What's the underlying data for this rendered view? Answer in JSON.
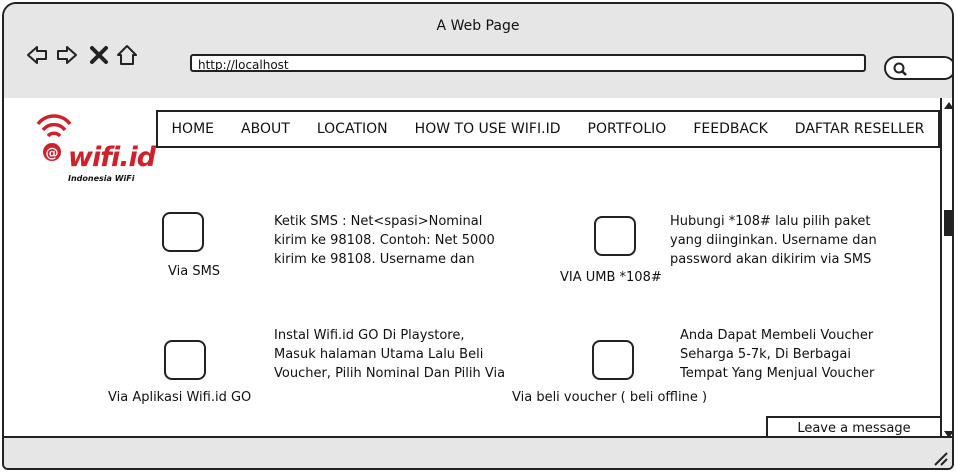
{
  "window": {
    "title": "A Web Page",
    "url": "http://localhost",
    "nav_icons": [
      "back-arrow-icon",
      "forward-arrow-icon",
      "close-x-icon",
      "home-icon"
    ],
    "search_icon": "search-icon"
  },
  "logo": {
    "brand": "wifi.id",
    "tagline": "Indonesia WiFi",
    "color": "#d0202a"
  },
  "menu": {
    "items": [
      "HOME",
      "ABOUT",
      "LOCATION",
      "HOW TO USE WIFI.ID",
      "PORTFOLIO",
      "FEEDBACK",
      "DAFTAR RESELLER"
    ]
  },
  "methods": [
    {
      "label": "Via SMS",
      "lines": [
        "Ketik SMS : Net<spasi>Nominal",
        "kirim ke 98108. Contoh: Net 5000",
        "kirim ke 98108. Username dan"
      ]
    },
    {
      "label": "VIA UMB *108#",
      "lines": [
        "Hubungi *108# lalu pilih paket",
        "yang diinginkan. Username dan",
        "password akan dikirim via SMS"
      ]
    },
    {
      "label": "Via Aplikasi Wifi.id GO",
      "lines": [
        "Instal Wifi.id GO Di Playstore,",
        "Masuk halaman Utama Lalu Beli",
        "Voucher, Pilih Nominal Dan Pilih Via"
      ]
    },
    {
      "label": "Via beli voucher  ( beli offline )",
      "lines": [
        "Anda Dapat Membeli Voucher",
        "Seharga 5-7k, Di Berbagai",
        "Tempat Yang Menjual Voucher"
      ]
    }
  ],
  "actions": {
    "leave_message": "Leave a message"
  }
}
